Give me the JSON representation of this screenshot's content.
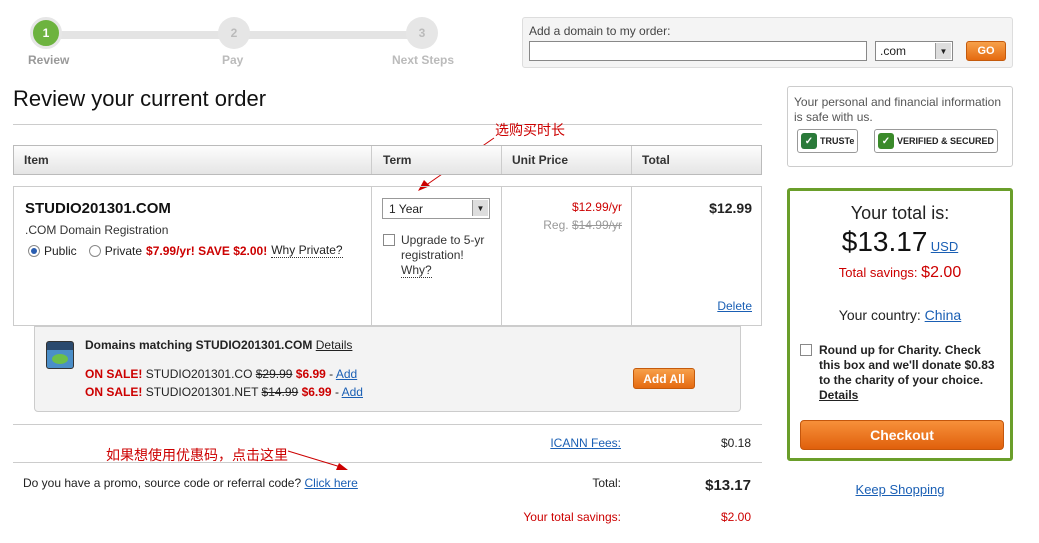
{
  "steps": [
    {
      "number": "1",
      "label": "Review"
    },
    {
      "number": "2",
      "label": "Pay"
    },
    {
      "number": "3",
      "label": "Next Steps"
    }
  ],
  "add_domain": {
    "label": "Add a domain to my order:",
    "input_value": "",
    "tld": ".com",
    "go_label": "GO"
  },
  "page_title": "Review your current order",
  "table": {
    "headers": [
      "Item",
      "Term",
      "Unit Price",
      "Total"
    ]
  },
  "item": {
    "name": "STUDIO201301.COM",
    "type": ".COM Domain Registration",
    "public_label": "Public",
    "private_label": "Private",
    "private_price": "$7.99/yr! SAVE $2.00!",
    "why_private": "Why Private?",
    "term": "1 Year",
    "upgrade_text": "Upgrade to 5-yr registration!",
    "why": "Why?",
    "unit_price": "$12.99/yr",
    "reg_label": "Reg.",
    "reg_price": "$14.99/yr",
    "total": "$12.99",
    "delete": "Delete"
  },
  "matching": {
    "title_prefix": "Domains matching STUDIO201301.COM",
    "details": "Details",
    "add_all": "Add All",
    "rows": [
      {
        "sale": "ON SALE!",
        "domain": "STUDIO201301.CO",
        "old_price": "$29.99",
        "new_price": "$6.99",
        "add": "Add"
      },
      {
        "sale": "ON SALE!",
        "domain": "STUDIO201301.NET",
        "old_price": "$14.99",
        "new_price": "$6.99",
        "add": "Add"
      }
    ]
  },
  "fees": {
    "icann_label": "ICANN Fees:",
    "icann_value": "$0.18",
    "total_label": "Total:",
    "total_value": "$13.17",
    "savings_label": "Your total savings:",
    "savings_value": "$2.00"
  },
  "promo": {
    "text": "Do you have a promo, source code or referral code?",
    "link": "Click here"
  },
  "annotations": {
    "term_note": "选购买时长",
    "promo_note": "如果想使用优惠码，点击这里"
  },
  "secure": {
    "text": "Your personal and financial information is safe with us.",
    "truste": "TRUSTe",
    "verified": "VERIFIED & SECURED"
  },
  "summary": {
    "your_total_is": "Your total is:",
    "amount": "$13.17",
    "currency": "USD",
    "savings_label": "Total savings:",
    "savings_value": "$2.00",
    "country_label": "Your country:",
    "country": "China",
    "charity_text": "Round up for Charity. Check this box and we'll donate $0.83 to the charity of your choice.",
    "charity_details": "Details",
    "checkout": "Checkout",
    "keep_shopping": "Keep Shopping"
  },
  "colors": {
    "accent_orange": "#e56a10",
    "sale_red": "#cc0000",
    "step_green": "#6db33f",
    "summary_border": "#6a9e2a"
  }
}
